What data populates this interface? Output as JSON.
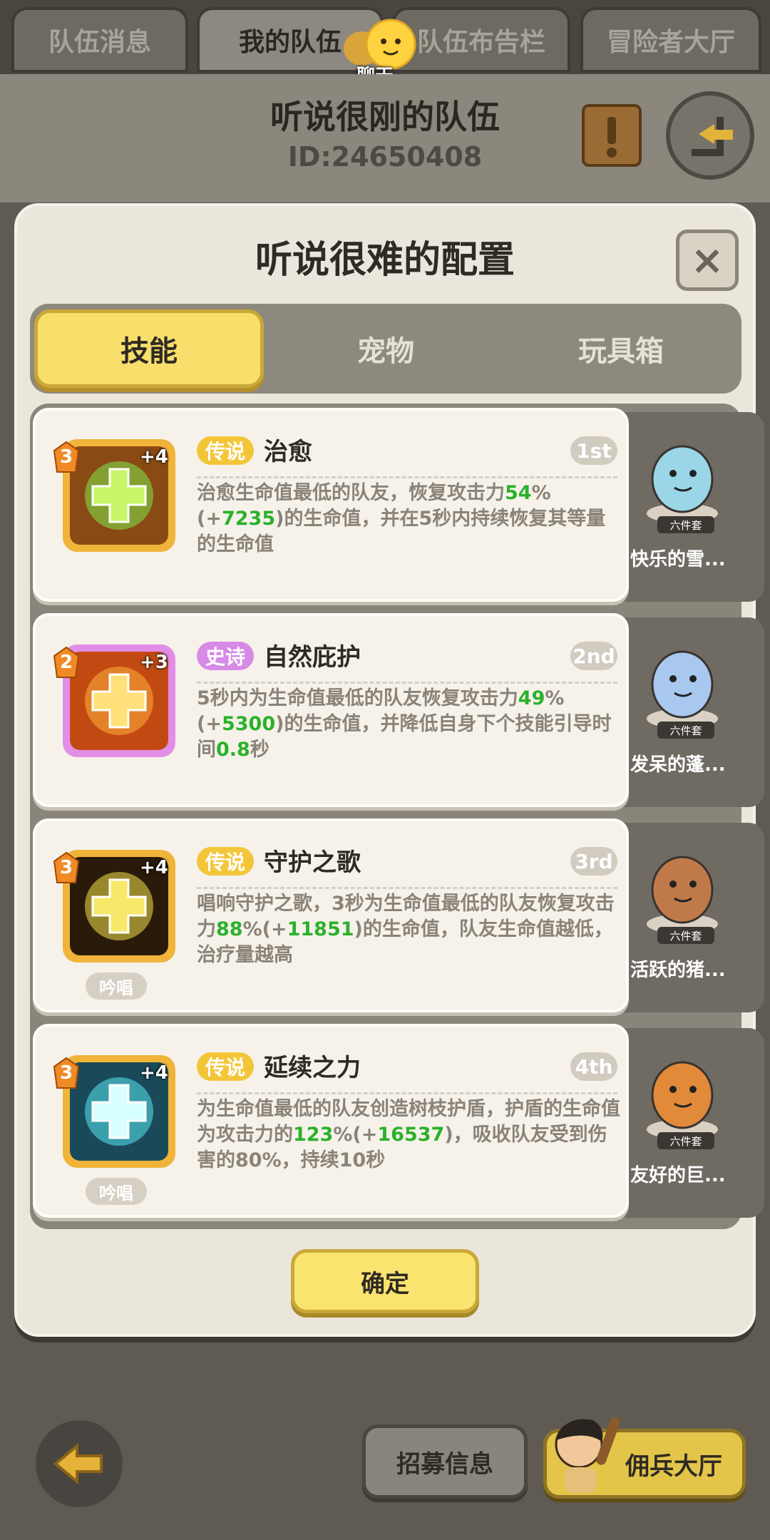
{
  "top_tabs": [
    "队伍消息",
    "我的队伍",
    "队伍布告栏",
    "冒险者大厅"
  ],
  "chat_label": "聊天",
  "team": {
    "name": "听说很刚的队伍",
    "id": "ID:24650408"
  },
  "modal": {
    "title": "听说很难的配置",
    "close": "×",
    "tabs": [
      "技能",
      "宠物",
      "玩具箱"
    ],
    "active_tab": "技能",
    "confirm": "确定"
  },
  "skills": [
    {
      "level": "3",
      "plus": "+4",
      "rarity": "传说",
      "name": "治愈",
      "rank": "1st",
      "desc_parts": [
        "治愈生命值最低的队友，恢复攻击力",
        "54",
        "%(+",
        "7235",
        ")的生命值，并在5秒内持续恢复其等量的生命值"
      ],
      "cast": "",
      "pet_name": "快乐的雪...",
      "pet_set": "六件套"
    },
    {
      "level": "2",
      "plus": "+3",
      "rarity": "史诗",
      "name": "自然庇护",
      "rank": "2nd",
      "desc_parts": [
        "5秒内为生命值最低的队友恢复攻击力",
        "49",
        "%(+",
        "5300",
        ")的生命值，并降低自身下个技能引导时间",
        "0.8",
        "秒"
      ],
      "cast": "",
      "pet_name": "发呆的蓬...",
      "pet_set": "六件套"
    },
    {
      "level": "3",
      "plus": "+4",
      "rarity": "传说",
      "name": "守护之歌",
      "rank": "3rd",
      "desc_parts": [
        "唱响守护之歌，3秒为生命值最低的队友恢复攻击力",
        "88",
        "%(+",
        "11851",
        ")的生命值，队友生命值越低，治疗量越高"
      ],
      "cast": "吟唱",
      "pet_name": "活跃的猪...",
      "pet_set": "六件套"
    },
    {
      "level": "3",
      "plus": "+4",
      "rarity": "传说",
      "name": "延续之力",
      "rank": "4th",
      "desc_parts": [
        "为生命值最低的队友创造树枝护盾，护盾的生命值为攻击力的",
        "123",
        "%(+",
        "16537",
        ")，吸收队友受到伤害的80%，持续10秒"
      ],
      "cast": "吟唱",
      "pet_name": "友好的巨...",
      "pet_set": "六件套"
    }
  ],
  "bottom": {
    "recruit": "招募信息",
    "mercenary": "佣兵大厅"
  },
  "colors": {
    "accent_yellow": "#f8de6b",
    "legend": "#f3c63a",
    "epic": "#d78ae6",
    "value_green": "#2bb12b"
  }
}
